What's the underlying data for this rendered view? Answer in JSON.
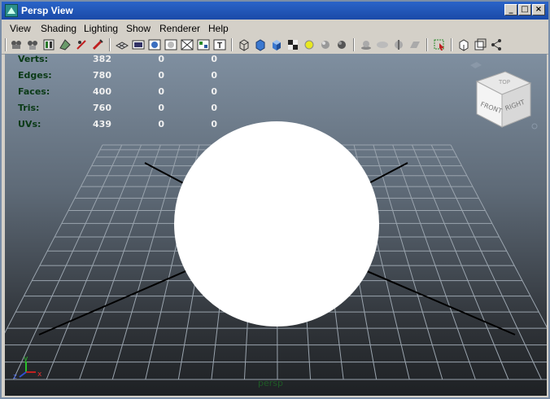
{
  "window": {
    "title": "Persp View"
  },
  "title_buttons": {
    "minimize": "_",
    "maximize": "□",
    "close": "×"
  },
  "menu": [
    "View",
    "Shading",
    "Lighting",
    "Show",
    "Renderer",
    "Help"
  ],
  "toolbar_icons": [
    "select-camera-icon",
    "lock-camera-icon",
    "camera-attributes-icon",
    "bookmark-icon",
    "image-plane-icon",
    "2d-pan-icon",
    "grid-icon",
    "film-gate-icon",
    "resolution-gate-icon",
    "gate-mask-icon",
    "field-chart-icon",
    "safe-action-icon",
    "safe-title-icon",
    "wireframe-icon",
    "smooth-shade-icon",
    "flat-shade-icon",
    "textured-icon",
    "use-default-material-icon",
    "use-all-lights-icon",
    "shadows-icon",
    "screen-space-ao-icon",
    "motion-blur-icon",
    "anti-aliasing-icon",
    "depth-of-field-icon",
    "isolate-select-icon",
    "xray-icon",
    "xray-joints-icon",
    "backface-culling-icon"
  ],
  "stats": {
    "rows": [
      {
        "label": "Verts:",
        "values": [
          "382",
          "0",
          "0"
        ]
      },
      {
        "label": "Edges:",
        "values": [
          "780",
          "0",
          "0"
        ]
      },
      {
        "label": "Faces:",
        "values": [
          "400",
          "0",
          "0"
        ]
      },
      {
        "label": "Tris:",
        "values": [
          "760",
          "0",
          "0"
        ]
      },
      {
        "label": "UVs:",
        "values": [
          "439",
          "0",
          "0"
        ]
      }
    ]
  },
  "viewcube": {
    "top": "TOP",
    "front": "FRONT",
    "right": "RIGHT"
  },
  "axis": {
    "x": "x",
    "y": "y",
    "z": "z"
  },
  "camera_label": "persp",
  "colors": {
    "viewport_top": "#7f8fa0",
    "viewport_bottom": "#1e2124",
    "hud_label": "#0a3a16",
    "title_bar": "#1a4aa8"
  }
}
